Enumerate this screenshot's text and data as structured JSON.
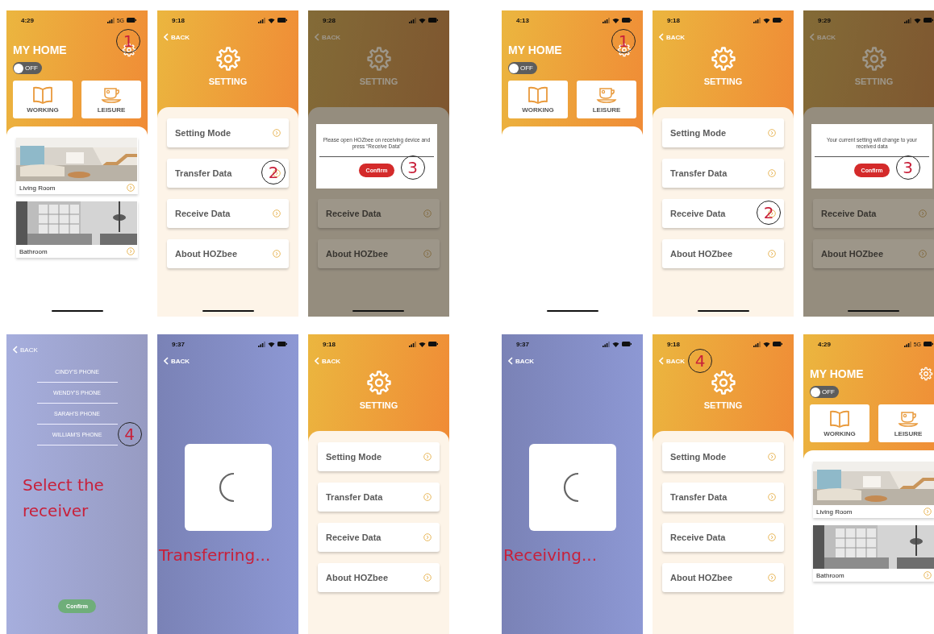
{
  "flows": [
    {
      "panels": [
        {
          "kind": "home",
          "status": {
            "time": "4:29",
            "network": "5G"
          },
          "title": "MY HOME",
          "gear_marker": "1",
          "toggle": {
            "label": "OFF",
            "on": false
          },
          "modes": [
            {
              "kind": "book",
              "label": "WORKING"
            },
            {
              "kind": "cup",
              "label": "LEISURE"
            }
          ],
          "rooms": [
            {
              "name": "Living Room",
              "kind": "picture"
            },
            {
              "name": "Bathroom",
              "kind": "picture"
            }
          ]
        },
        {
          "kind": "setting",
          "status": {
            "time": "9:18"
          },
          "back": {
            "label": "BACK"
          },
          "title": "SETTING",
          "items": [
            {
              "label": "Setting Mode"
            },
            {
              "label": "Transfer Data",
              "marker": "2"
            },
            {
              "label": "Receive Data"
            },
            {
              "label": "About HOZbee"
            }
          ]
        },
        {
          "kind": "dialog",
          "status": {
            "time": "9:28"
          },
          "back": {
            "label": "BACK"
          },
          "title": "SETTING",
          "dialog": {
            "message": "Please open HOZbee on receiving device and press “Receive Data”",
            "confirm": {
              "label": "Confirm",
              "marker": "3"
            }
          },
          "items": [
            {
              "label": "Receive Data"
            },
            {
              "label": "About HOZbee"
            }
          ]
        },
        {
          "kind": "picker",
          "back": {
            "label": "BACK"
          },
          "devices": [
            {
              "label": "CINDY'S PHONE"
            },
            {
              "label": "WENDY'S PHONE"
            },
            {
              "label": "SARAH'S PHONE"
            },
            {
              "label": "WILLIAM'S PHONE",
              "marker": "4"
            }
          ],
          "caption": "Select the receiver",
          "confirm": {
            "label": "Confirm"
          }
        },
        {
          "kind": "progress",
          "status": {
            "time": "9:37"
          },
          "back": {
            "label": "BACK"
          },
          "caption": "Transferring..."
        },
        {
          "kind": "setting",
          "status": {
            "time": "9:18"
          },
          "back": {
            "label": "BACK"
          },
          "title": "SETTING",
          "items": [
            {
              "label": "Setting Mode"
            },
            {
              "label": "Transfer Data"
            },
            {
              "label": "Receive Data"
            },
            {
              "label": "About HOZbee"
            }
          ]
        }
      ]
    },
    {
      "panels": [
        {
          "kind": "home",
          "status": {
            "time": "4:13"
          },
          "title": "MY HOME",
          "gear_marker": "1",
          "toggle": {
            "label": "OFF",
            "on": false
          },
          "modes": [
            {
              "kind": "book",
              "label": "WORKING"
            },
            {
              "kind": "cup",
              "label": "LEISURE"
            }
          ]
        },
        {
          "kind": "setting",
          "status": {
            "time": "9:18"
          },
          "back": {
            "label": "BACK"
          },
          "title": "SETTING",
          "items": [
            {
              "label": "Setting Mode"
            },
            {
              "label": "Transfer Data"
            },
            {
              "label": "Receive Data",
              "marker": "2"
            },
            {
              "label": "About HOZbee"
            }
          ]
        },
        {
          "kind": "dialog",
          "status": {
            "time": "9:29"
          },
          "back": {
            "label": "BACK"
          },
          "title": "SETTING",
          "dialog": {
            "message": "Your current setting will change to your received data",
            "confirm": {
              "label": "Confirm",
              "marker": "3"
            }
          },
          "items": [
            {
              "label": "Receive Data"
            },
            {
              "label": "About HOZbee"
            }
          ]
        },
        {
          "kind": "progress",
          "status": {
            "time": "9:37"
          },
          "back": {
            "label": "BACK"
          },
          "caption": "Receiving..."
        },
        {
          "kind": "setting",
          "status": {
            "time": "9:18"
          },
          "back": {
            "label": "BACK",
            "marker": "4"
          },
          "title": "SETTING",
          "items": [
            {
              "label": "Setting Mode"
            },
            {
              "label": "Transfer Data"
            },
            {
              "label": "Receive Data"
            },
            {
              "label": "About HOZbee"
            }
          ]
        },
        {
          "kind": "home",
          "status": {
            "time": "4:29",
            "network": "5G"
          },
          "title": "MY HOME",
          "toggle": {
            "label": "OFF",
            "on": false
          },
          "modes": [
            {
              "kind": "book",
              "label": "WORKING"
            },
            {
              "kind": "cup",
              "label": "LEISURE"
            }
          ],
          "rooms": [
            {
              "name": "Living Room",
              "kind": "picture"
            },
            {
              "name": "Bathroom",
              "kind": "picture"
            }
          ]
        }
      ]
    }
  ]
}
